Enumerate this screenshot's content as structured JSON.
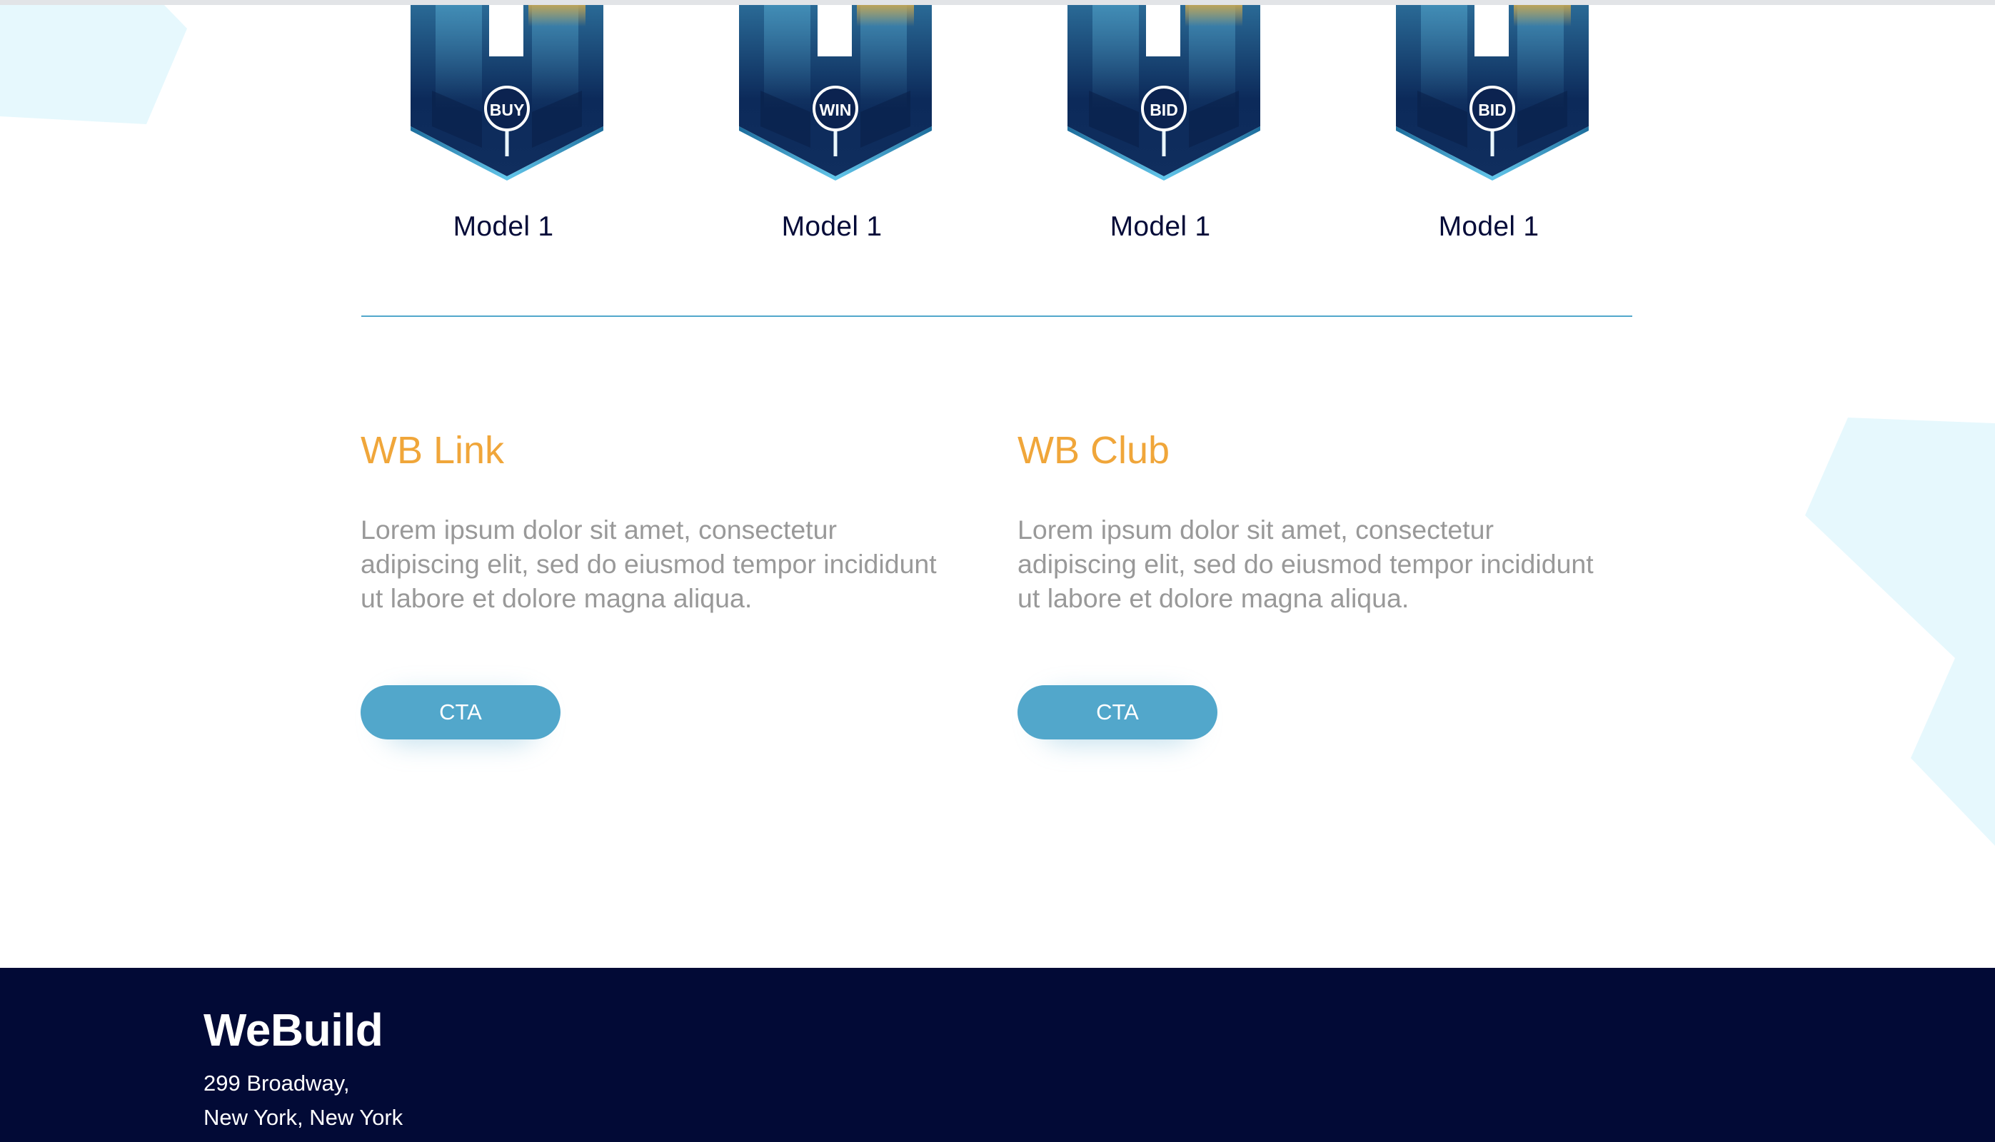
{
  "colors": {
    "accent": "#f0a63a",
    "button": "#52a7cb",
    "footer_bg": "#020a36",
    "label_dark": "#050b38",
    "body_text": "#999999",
    "divider": "#52a7cb"
  },
  "models": [
    {
      "badge_text": "BUY",
      "label": "Model 1"
    },
    {
      "badge_text": "WIN",
      "label": "Model 1"
    },
    {
      "badge_text": "BID",
      "label": "Model 1"
    },
    {
      "badge_text": "BID",
      "label": "Model 1"
    }
  ],
  "features": [
    {
      "title": "WB Link",
      "text": "Lorem ipsum dolor sit amet, consectetur adipiscing elit, sed do eiusmod tempor incididunt ut labore et dolore magna aliqua.",
      "cta_label": "CTA"
    },
    {
      "title": "WB Club",
      "text": "Lorem ipsum dolor sit amet, consectetur adipiscing elit, sed do eiusmod tempor incididunt ut labore et dolore magna aliqua.",
      "cta_label": "CTA"
    }
  ],
  "footer": {
    "brand": "WeBuild",
    "address_line1": "299 Broadway,",
    "address_line2": "New York, New York"
  }
}
